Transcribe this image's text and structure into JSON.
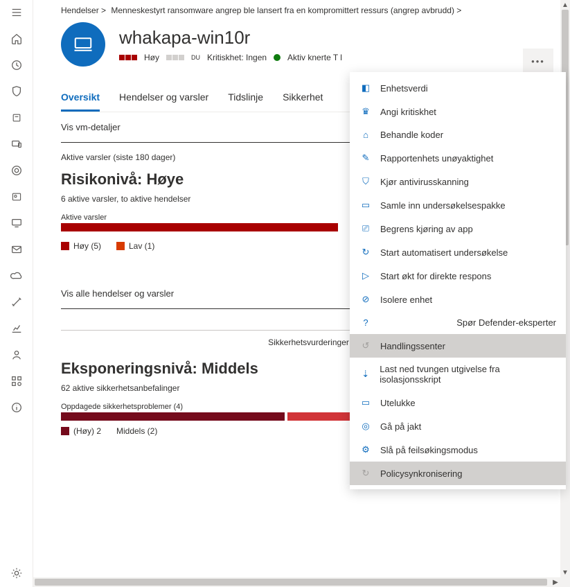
{
  "breadcrumb": {
    "a": "Hendelser >",
    "b": "Menneskestyrt ransomware angrep ble lansert fra en kompromittert ressurs (angrep avbrudd) >"
  },
  "device": {
    "name": "whakapa-win10r",
    "risk_label": "Høy",
    "du_badge": "DU",
    "criticality_label": "Kritiskhet: Ingen",
    "status_text": "Aktiv knerte T l"
  },
  "tabs": {
    "overview": "Oversikt",
    "events": "Hendelser og varsler",
    "timeline": "Tidslinje",
    "security": "Sikkerhet"
  },
  "links": {
    "vm_details": "Vis vm-detaljer",
    "all_events": "Vis alle hendelser og varsler"
  },
  "alerts_section": {
    "heading": "Aktive varsler (siste 180 dager)",
    "risk_title": "Risikonivå: Høye",
    "subtitle": "6 aktive varsler, to aktive hendelser",
    "bar_label": "Aktive varsler",
    "legend_high": "Høy (5)",
    "legend_low": "Lav (1)"
  },
  "sec_eval_label": "Sikkerhetsvurderinger",
  "exposure": {
    "title": "Eksponeringsnivå: Middels",
    "subtitle": "62 aktive sikkerhetsanbefalinger",
    "bar_label": "Oppdagede sikkerhetsproblemer (4)",
    "legend_a": "(Høy) 2",
    "legend_b": "Middels (2)"
  },
  "menu": {
    "items": [
      "Enhetsverdi",
      "Angi kritiskhet",
      "Behandle koder",
      "Rapportenhets unøyaktighet",
      "Kjør antivirusskanning",
      "Samle inn undersøkelsespakke",
      "Begrens kjøring av app",
      "Start automatisert undersøkelse",
      "Start økt for direkte respons",
      "Isolere enhet"
    ],
    "ask_experts": "Spør Defender-eksperter",
    "items2": [
      "Handlingssenter",
      "Last ned tvungen utgivelse fra isolasjonsskript",
      "Utelukke",
      "Gå på jakt",
      "Slå på feilsøkingsmodus",
      "Policysynkronisering"
    ]
  }
}
